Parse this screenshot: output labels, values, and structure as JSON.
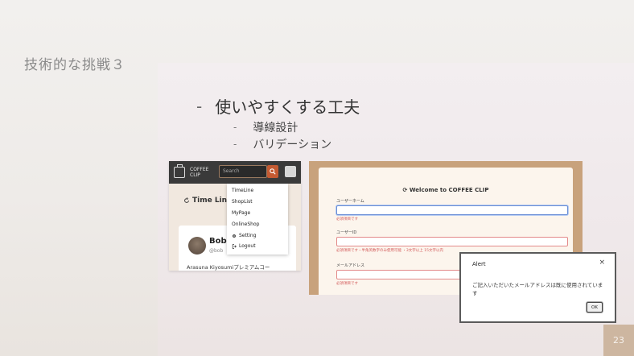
{
  "slide": {
    "title": "技術的な挑戦３",
    "bullet_main": "使いやすくする工夫",
    "sub_bullets": [
      "導線設計",
      "バリデーション"
    ],
    "page_number": "23",
    "dash": "-"
  },
  "app": {
    "name": "COFFEE CLIP",
    "search_placeholder": "Search",
    "timeline_label": "Time Line",
    "menu": [
      "TimeLine",
      "ShopList",
      "MyPage",
      "OnlineShop",
      "Setting",
      "Logout"
    ],
    "post": {
      "name": "Bob",
      "handle": "@bob",
      "text": "Arasuna Kiyosumiプレミアムコー"
    }
  },
  "form": {
    "title": "Welcome to COFFEE CLIP",
    "fields": [
      {
        "label": "ユーザーネーム",
        "error": "必須項目です"
      },
      {
        "label": "ユーザーID",
        "error": "必須項目です・半角英数字のみ使用可能 ・3文字以上 15文字以内"
      },
      {
        "label": "メールアドレス",
        "error": "必須項目です"
      }
    ]
  },
  "alert": {
    "title": "Alert",
    "close": "×",
    "message": "ご記入いただいたメールアドレスは既に使用されています",
    "ok_label": "OK"
  },
  "colors": {
    "app_header": "#3a3a3a",
    "search_button": "#c45a32",
    "error_text": "#d35b5b",
    "panel_background": "#f3eef0",
    "page_badge": "#cdb6a0"
  },
  "icons": {
    "search_button": "search-icon",
    "logo": "coffee-cup-icon",
    "timeline": "refresh-icon",
    "setting": "gear-icon",
    "logout": "logout-icon",
    "form_title": "refresh-icon",
    "alert_close": "close-icon"
  }
}
